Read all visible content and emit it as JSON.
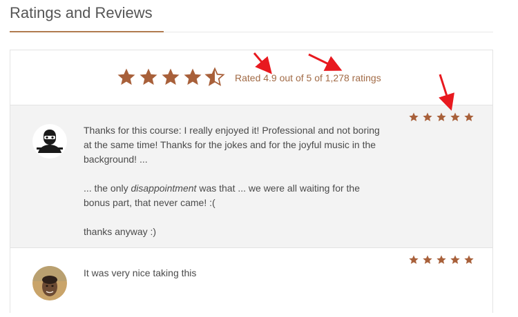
{
  "section": {
    "title": "Ratings and Reviews"
  },
  "summary": {
    "rating_text": "Rated 4.9 out of 5 of 1,278 ratings",
    "star_fill": [
      1,
      1,
      1,
      1,
      0.5
    ]
  },
  "reviews": [
    {
      "stars": 5,
      "avatar_icon": "masked-person-avatar-icon",
      "paragraphs": [
        "Thanks for this course: I really enjoyed it! Professional and not boring at the same time! Thanks for the jokes and for the joyful music in the background! ...",
        "thanks anyway :)"
      ],
      "para2": {
        "before": "... the only ",
        "emphasis": "disappointment",
        "after": " was that ... we were all waiting for the bonus part, that never came! :("
      }
    },
    {
      "stars": 5,
      "avatar_icon": "person-photo-avatar",
      "paragraphs": [
        "It was very nice taking this"
      ]
    }
  ],
  "colors": {
    "star": "#a8603a",
    "rating_text": "#a16a45",
    "accent": "#b07a4e",
    "annotation_arrow": "#e8191f"
  },
  "annotations": {
    "arrow_count": 3,
    "arrow_icon": "red-arrow-icon"
  }
}
